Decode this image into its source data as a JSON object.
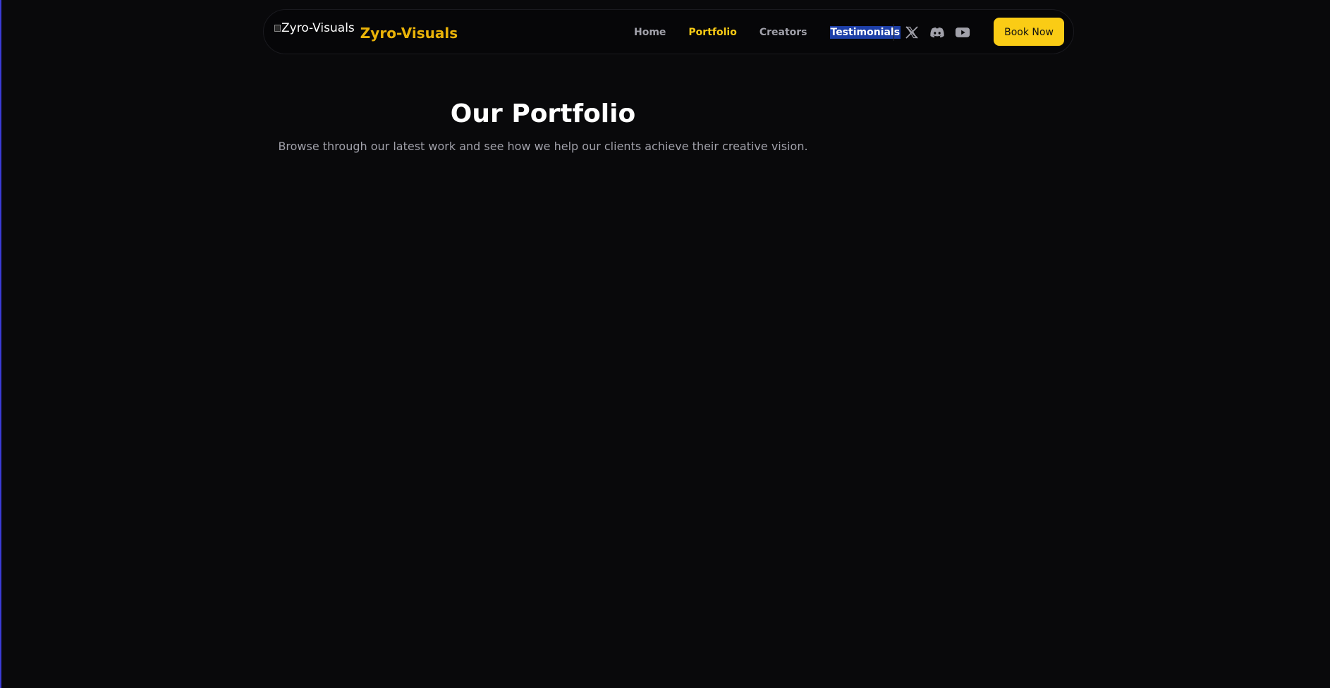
{
  "brand": {
    "logo_alt": "Zyro-Visuals",
    "name": "Zyro-Visuals",
    "color": "#eab308"
  },
  "nav": {
    "links": [
      {
        "label": "Home",
        "state": "normal"
      },
      {
        "label": "Portfolio",
        "state": "active"
      },
      {
        "label": "Creators",
        "state": "normal"
      },
      {
        "label": "Testimonials",
        "state": "selected"
      }
    ],
    "socials": [
      {
        "icon": "x-icon"
      },
      {
        "icon": "discord-icon"
      },
      {
        "icon": "youtube-icon"
      }
    ],
    "cta_label": "Book Now",
    "accent": "#facc15"
  },
  "hero": {
    "title": "Our Portfolio",
    "subtitle": "Browse through our latest work and see how we help our clients achieve their creative vision."
  }
}
